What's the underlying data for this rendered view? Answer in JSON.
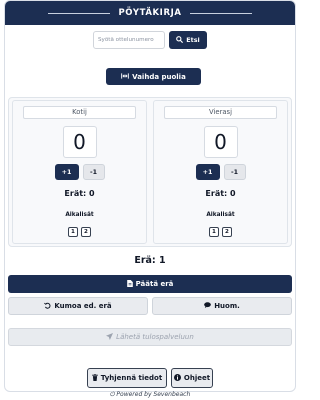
{
  "header": {
    "title": "PÖYTÄKIRJA"
  },
  "search": {
    "placeholder": "Syötä ottelunumero",
    "button_label": "Etsi"
  },
  "switch": {
    "label": "Vaihda puolia"
  },
  "home": {
    "name": "Kotij",
    "score": "0",
    "plus": "+1",
    "minus": "-1",
    "sets": "Erät: 0",
    "timeouts_label": "Aikalisät",
    "timeouts": [
      "1",
      "2"
    ]
  },
  "away": {
    "name": "Vierasj",
    "score": "0",
    "plus": "+1",
    "minus": "-1",
    "sets": "Erät: 0",
    "timeouts_label": "Aikalisät",
    "timeouts": [
      "1",
      "2"
    ]
  },
  "current_set": "Erä: 1",
  "actions": {
    "end_set": "Päätä erä",
    "undo_set": "Kumoa ed. erä",
    "note": "Huom.",
    "send": "Lähetä tulospalveluun",
    "clear": "Tyhjennä tiedot",
    "help": "Ohjeet"
  },
  "footer": "Powered by Sevenbeach",
  "colors": {
    "primary": "#1c2e52",
    "light_button": "#e9ebef",
    "disabled_text": "#9ca3af"
  },
  "icons": {
    "search": "search-icon",
    "switch": "swap-icon",
    "end_set": "document-icon",
    "undo": "undo-icon",
    "note": "comment-icon",
    "send": "send-icon",
    "clear": "trash-icon",
    "help": "info-icon",
    "power": "power-icon"
  }
}
